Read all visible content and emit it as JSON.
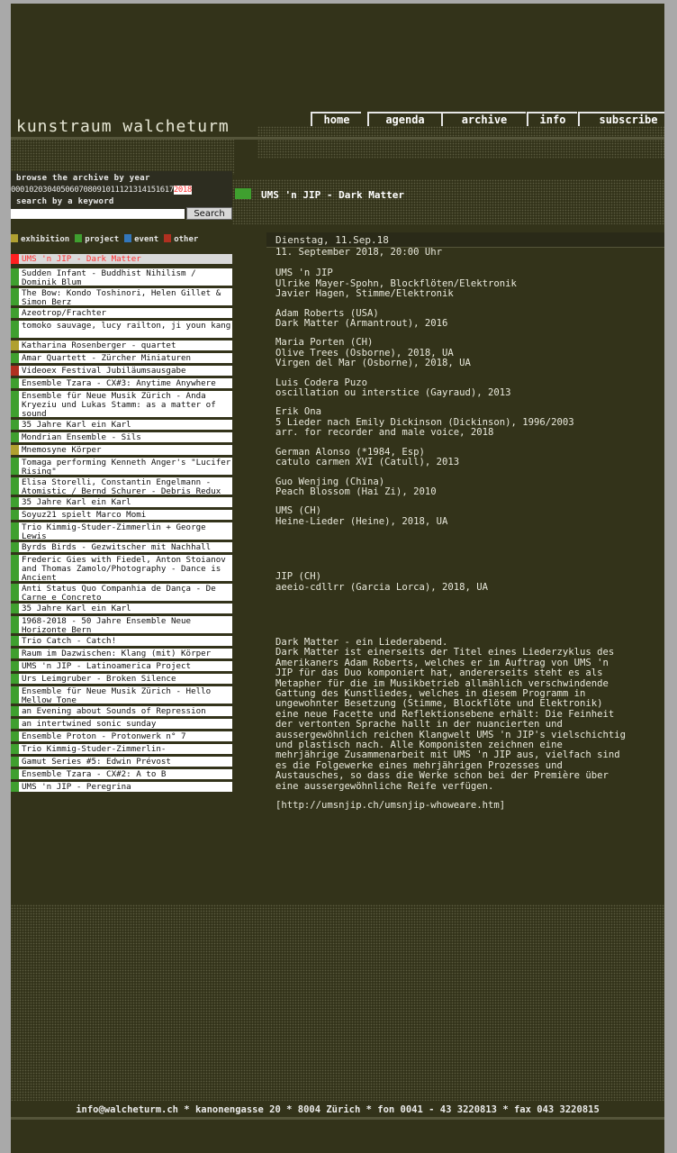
{
  "site": {
    "title": "kunstraum walcheturm"
  },
  "nav": [
    {
      "label": "home"
    },
    {
      "label": "agenda"
    },
    {
      "label": "archive"
    },
    {
      "label": "info"
    },
    {
      "label": "subscribe"
    }
  ],
  "archive": {
    "browse_label": "browse the archive by year",
    "years": [
      "00",
      "01",
      "02",
      "03",
      "04",
      "05",
      "06",
      "07",
      "08",
      "09",
      "10",
      "11",
      "12",
      "13",
      "14",
      "15",
      "16",
      "17",
      "2018"
    ],
    "current_year": "2018",
    "keyword_label": "search by a keyword",
    "search_value": "",
    "search_button": "Search"
  },
  "legend": [
    {
      "label": "exhibition",
      "color": "#b0a030"
    },
    {
      "label": "project",
      "color": "#3f9f2f"
    },
    {
      "label": "event",
      "color": "#3377bb"
    },
    {
      "label": "other",
      "color": "#b03020"
    }
  ],
  "events": [
    {
      "title": "UMS 'n JIP - Dark Matter",
      "category": "other-red",
      "selected": true
    },
    {
      "title": "Sudden Infant - Buddhist Nihilism / Dominik Blum",
      "category": "project"
    },
    {
      "title": "The Bow: Kondo Toshinori, Helen Gillet & Simon Berz",
      "category": "project"
    },
    {
      "title": "Azeotrop/Frachter",
      "category": "project"
    },
    {
      "title": "tomoko sauvage, lucy railton, ji youn kang",
      "category": "project"
    },
    {
      "title": "Katharina Rosenberger - quartet",
      "category": "exhibition"
    },
    {
      "title": "Amar Quartett - Zürcher Miniaturen",
      "category": "project"
    },
    {
      "title": "Videoex Festival Jubiläumsausgabe",
      "category": "other"
    },
    {
      "title": "Ensemble Tzara - CX#3: Anytime Anywhere",
      "category": "project"
    },
    {
      "title": "Ensemble für Neue Musik Zürich - Anda Kryeziu und Lukas Stamm: as a matter of sound",
      "category": "project"
    },
    {
      "title": "35 Jahre Karl ein Karl",
      "category": "project"
    },
    {
      "title": "Mondrian Ensemble - Sils",
      "category": "project"
    },
    {
      "title": "Mnemosyne Körper",
      "category": "exhibition"
    },
    {
      "title": "Tomaga performing Kenneth Anger's \"Lucifer Rising\"",
      "category": "project"
    },
    {
      "title": "Elisa Storelli, Constantin Engelmann - Atomistic / Bernd Schurer - Debris Redux",
      "category": "project"
    },
    {
      "title": "35 Jahre Karl ein Karl",
      "category": "project"
    },
    {
      "title": "Soyuz21 spielt Marco Momi",
      "category": "project"
    },
    {
      "title": "Trio Kimmig-Studer-Zimmerlin + George Lewis",
      "category": "project"
    },
    {
      "title": "Byrds Birds - Gezwitscher mit Nachhall",
      "category": "project"
    },
    {
      "title": "Frederic Gies with Fiedel, Anton Stoianov and Thomas Zamolo/Photography - Dance is Ancient",
      "category": "project"
    },
    {
      "title": "Anti Status Quo Companhia de Dança - De Carne e Concreto",
      "category": "project"
    },
    {
      "title": "35 Jahre Karl ein Karl",
      "category": "project"
    },
    {
      "title": "1968-2018 - 50 Jahre Ensemble Neue Horizonte Bern",
      "category": "project"
    },
    {
      "title": "Trio Catch - Catch!",
      "category": "project"
    },
    {
      "title": "Raum im Dazwischen: Klang (mit) Körper",
      "category": "project"
    },
    {
      "title": "UMS 'n JIP - Latinoamerica Project",
      "category": "project"
    },
    {
      "title": "Urs Leimgruber - Broken Silence",
      "category": "project"
    },
    {
      "title": "Ensemble für Neue Musik Zürich - Hello Mellow Tone",
      "category": "project"
    },
    {
      "title": "an Evening about Sounds of Repression",
      "category": "project"
    },
    {
      "title": "an intertwined sonic sunday",
      "category": "project"
    },
    {
      "title": "Ensemble Proton - Protonwerk n° 7",
      "category": "project"
    },
    {
      "title": "Trio Kimmig-Studer-Zimmerlin-",
      "category": "project"
    },
    {
      "title": "Gamut Series #5: Edwin Prévost",
      "category": "project"
    },
    {
      "title": "Ensemble Tzara - CX#2: A to B",
      "category": "project"
    },
    {
      "title": "UMS 'n JIP - Peregrina",
      "category": "project"
    }
  ],
  "detail": {
    "title": "UMS 'n JIP - Dark Matter",
    "date_header": "Dienstag, 11.Sep.18",
    "paragraphs": [
      "11. September 2018, 20:00 Uhr",
      "UMS 'n JIP\nUlrike Mayer-Spohn, Blockflöten/Elektronik\nJavier Hagen, Stimme/Elektronik",
      "Adam Roberts (USA)\nDark Matter (Armantrout), 2016",
      "Maria Porten (CH)\nOlive Trees (Osborne), 2018, UA\nVirgen del Mar (Osborne), 2018, UA",
      "Luis Codera Puzo\noscillation ou interstice (Gayraud), 2013",
      "Erik Ona\n5 Lieder nach Emily Dickinson (Dickinson), 1996/2003\narr. for recorder and male voice, 2018",
      "German Alonso (*1984, Esp)\ncatulo carmen XVI (Catull), 2013",
      "Guo Wenjing (China)\nPeach Blossom (Hai Zi), 2010",
      "UMS (CH)\nHeine-Lieder (Heine), 2018, UA",
      "JIP (CH)\naeeio-cdllrr (Garcia Lorca), 2018, UA",
      "Dark Matter - ein Liederabend.\nDark Matter ist einerseits der Titel eines Liederzyklus des\nAmerikaners Adam Roberts, welches er im Auftrag von UMS 'n\nJIP für das Duo komponiert hat, andererseits steht es als\nMetapher für die im Musikbetrieb allmählich verschwindende\nGattung des Kunstliedes, welches in diesem Programm in\nungewohnter Besetzung (Stimme, Blockflöte und Elektronik)\neine neue Facette und Reflektionsebene erhält: Die Feinheit\nder vertonten Sprache hallt in der nuancierten und\naussergewöhnlich reichen Klangwelt UMS 'n JIP's vielschichtig\nund plastisch nach. Alle Komponisten zeichnen eine\nmehrjährige Zusammenarbeit mit UMS 'n JIP aus, vielfach sind\nes die Folgewerke eines mehrjährigen Prozesses und\nAustausches, so dass die Werke schon bei der Première über\neine aussergewöhnliche Reife verfügen.",
      "[http://umsnjip.ch/umsnjip-whoweare.htm]"
    ]
  },
  "footer": {
    "text": "info@walcheturm.ch * kanonengasse 20 * 8004 Zürich * fon 0041 - 43 3220813 * fax 043 3220815"
  },
  "colors": {
    "background": "#33331a",
    "project": "#3f9f2f",
    "exhibition": "#b0a030",
    "event": "#3377bb",
    "other": "#b03020",
    "selected_text": "#ff3030"
  }
}
